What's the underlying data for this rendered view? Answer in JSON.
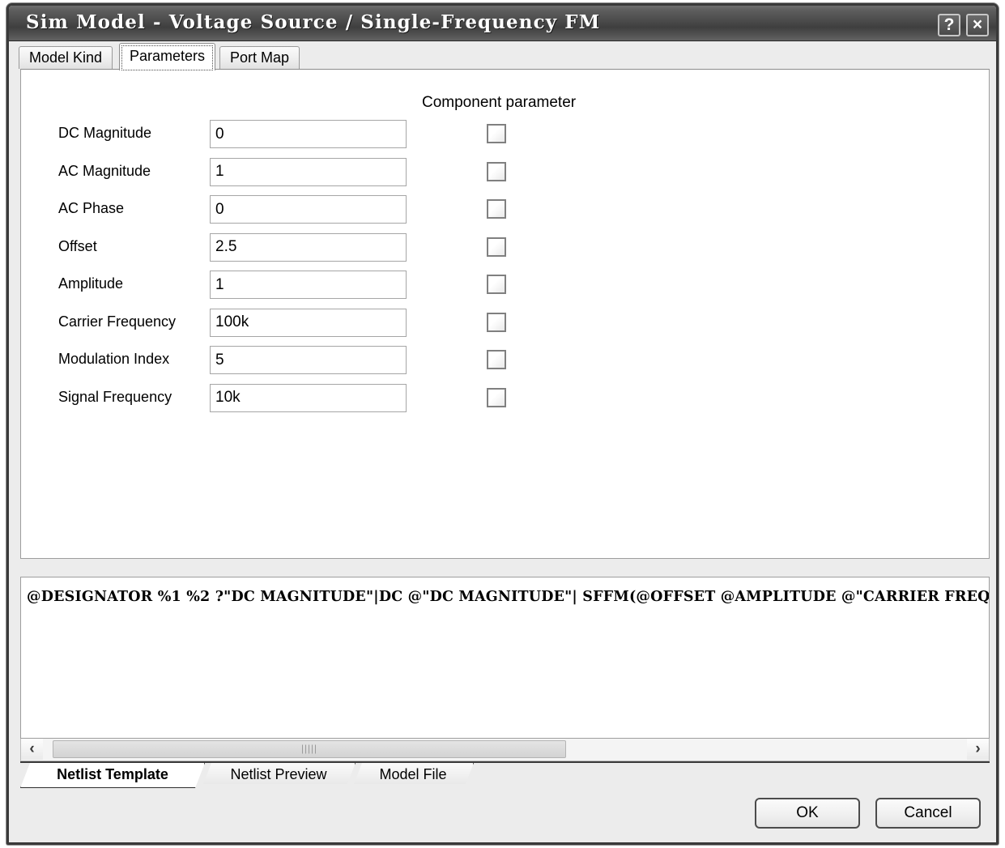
{
  "window": {
    "title": "Sim Model - Voltage Source / Single-Frequency FM",
    "help_label": "?",
    "close_label": "×"
  },
  "top_tabs": [
    {
      "label": "Model Kind",
      "active": false
    },
    {
      "label": "Parameters",
      "active": true
    },
    {
      "label": "Port Map",
      "active": false
    }
  ],
  "panel": {
    "component_parameter_header": "Component parameter",
    "parameters": [
      {
        "label": "DC Magnitude",
        "value": "0",
        "checked": false
      },
      {
        "label": "AC Magnitude",
        "value": "1",
        "checked": false
      },
      {
        "label": "AC Phase",
        "value": "0",
        "checked": false
      },
      {
        "label": "Offset",
        "value": "2.5",
        "checked": false
      },
      {
        "label": "Amplitude",
        "value": "1",
        "checked": false
      },
      {
        "label": "Carrier Frequency",
        "value": "100k",
        "checked": false
      },
      {
        "label": "Modulation Index",
        "value": "5",
        "checked": false
      },
      {
        "label": "Signal Frequency",
        "value": "10k",
        "checked": false
      }
    ]
  },
  "netlist": {
    "text": "@DESIGNATOR %1 %2 ?\"DC MAGNITUDE\"|DC @\"DC MAGNITUDE\"| SFFM(@OFFSET @AMPLITUDE @\"CARRIER FREQUENCY\" @\"MODULATION INDEX\" @\"SIGNAL FREQUENCY\")"
  },
  "scrollbar": {
    "left_arrow": "‹",
    "right_arrow": "›"
  },
  "bottom_tabs": [
    {
      "label": "Netlist Template",
      "active": true
    },
    {
      "label": "Netlist Preview",
      "active": false
    },
    {
      "label": "Model File",
      "active": false
    }
  ],
  "footer": {
    "ok_label": "OK",
    "cancel_label": "Cancel"
  },
  "colors": {
    "titlebar_dark": "#3f3f3f",
    "dialog_face": "#ececec",
    "panel_bg": "#ffffff",
    "border": "#9d9d9d"
  }
}
